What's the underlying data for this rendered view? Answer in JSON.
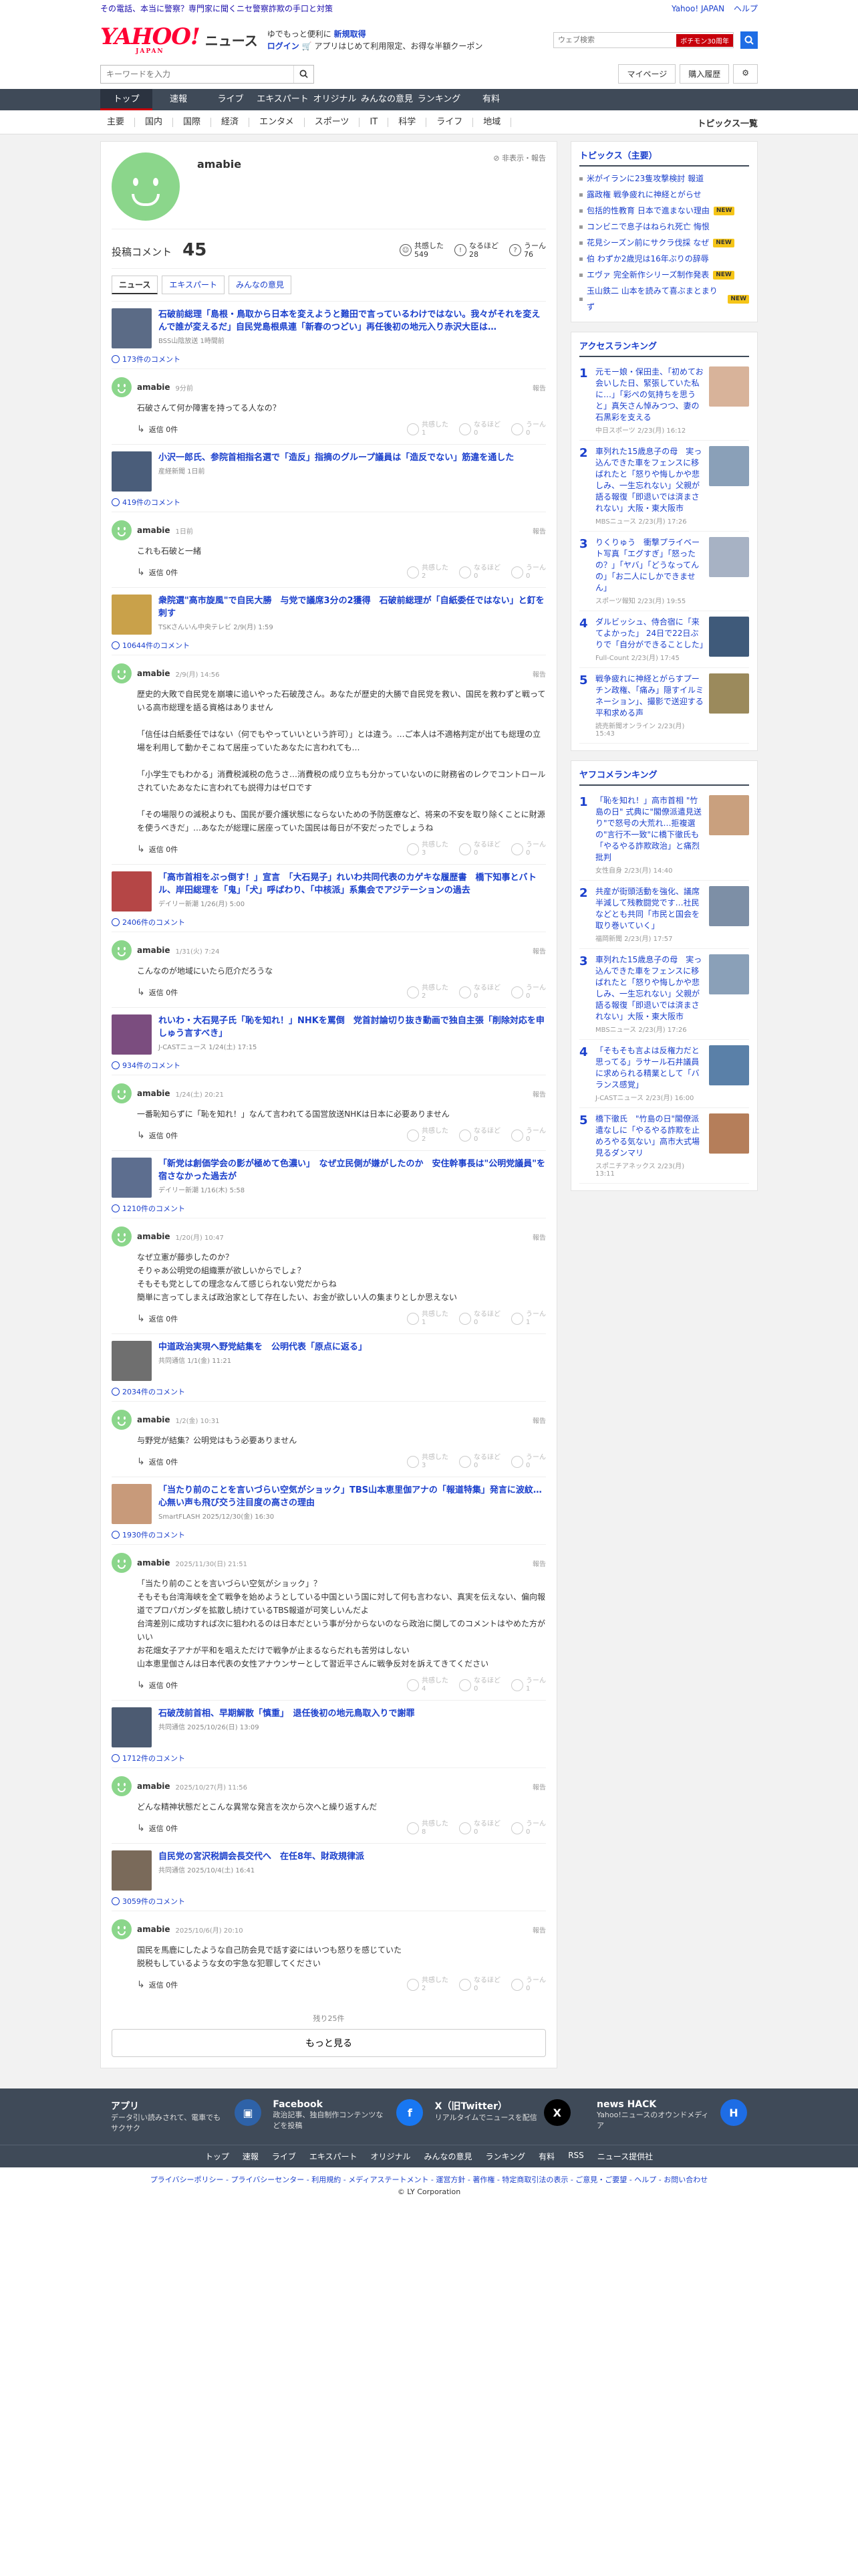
{
  "adbar": {
    "left": "その電話、本当に警察？専門家に聞くニセ警察詐欺の手口と対策",
    "right_links": [
      "Yahoo! JAPAN",
      "ヘルプ"
    ]
  },
  "header": {
    "logo_main": "YAHOO!",
    "logo_sub": "JAPAN",
    "logo_news": "ニュース",
    "promo_line1_a": "ゆでもっと便利に",
    "promo_line1_b": "新規取得",
    "promo_line2_a": "ログイン",
    "promo_line2_b": "アプリはじめて利用限定、お得な半額クーポン",
    "search_placeholder": "ウェブ検索",
    "search_tag": "ボチモン30周年"
  },
  "search_row": {
    "placeholder": "キーワードを入力",
    "mypage": "マイページ",
    "history": "購入履歴"
  },
  "nav": [
    "トップ",
    "速報",
    "ライブ",
    "エキスパート",
    "オリジナル",
    "みんなの意見",
    "ランキング",
    "有料"
  ],
  "subnav": [
    "主要",
    "国内",
    "国際",
    "経済",
    "エンタメ",
    "スポーツ",
    "IT",
    "科学",
    "ライフ",
    "地域"
  ],
  "subnav_all": "トピックス一覧",
  "profile": {
    "name": "amabie",
    "links": "非表示・報告",
    "comments_label": "投稿コメント",
    "comments_count": "45",
    "stats": [
      {
        "label": "共感した",
        "value": "549"
      },
      {
        "label": "なるほど",
        "value": "28"
      },
      {
        "label": "うーん",
        "value": "76"
      }
    ],
    "tabs": [
      "ニュース",
      "エキスパート",
      "みんなの意見"
    ]
  },
  "items": [
    {
      "title": "石破前総理「島根・鳥取から日本を変えようと難田で言っているわけではない。我々がそれを変えんで誰が変えるだ」自民党島根県連「新春のつどい」再任後初の地元入り赤沢大臣は…",
      "meta": "BSS山陰放送 1時間前",
      "thumb": "#5b6b86",
      "comment_count": "173件のコメント",
      "user": "amabie",
      "time": "9分前",
      "body": "石破さんて何か障害を持ってる人なの？",
      "reply": "返信 0件",
      "reacts": [
        "1",
        "0",
        "0"
      ]
    },
    {
      "title": "小沢一郎氏、参院首相指名選で「造反」指摘のグループ議員は「造反でない」筋違を通した",
      "meta": "産経新聞 1日前",
      "thumb": "#4a5d7a",
      "comment_count": "419件のコメント",
      "user": "amabie",
      "time": "1日前",
      "body": "これも石破と一緒",
      "reply": "返信 0件",
      "reacts": [
        "2",
        "0",
        "0"
      ]
    },
    {
      "title": "衆院選\"高市旋風\"で自民大勝　与党で議席3分の2獲得　石破前総理が「自紙委任ではない」と釘を刺す",
      "meta": "TSKさんいん中央テレビ 2/9(月) 1:59",
      "thumb": "#c9a14a",
      "comment_count": "10644件のコメント",
      "user": "amabie",
      "time": "2/9(月) 14:56",
      "body": "歴史的大敗で自民党を崩壊に追いやった石破茂さん。あなたが歴史的大勝で自民党を救い、国民を救わずと戦っている高市総理を語る資格はありません\n\n「信任は白紙委任ではない（何でもやっていいという許可）」とは違う。…ご本人は不適格判定が出ても総理の立場を利用して動かそこねて居座っていたあなたに言われても…\n\n「小学生でもわかる」消費税減税の危うさ…消費税の成り立ちも分かっていないのに財務省のレクでコントロールされていたあなたに言われても説得力はゼロです\n\n「その場限りの減税よりも、国民が要介護状態にならないための予防医療など、将来の不安を取り除くことに財源を使うべきだ」…あなたが総理に居座っていた国民は毎日が不安だったでしょうね",
      "reply": "返信 0件",
      "reacts": [
        "3",
        "0",
        "0"
      ]
    },
    {
      "title": "「高市首相をぶっ倒す！」宣言　「大石晃子」れいわ共同代表のカゲキな履歴書　橋下知事とバトル、岸田総理を「鬼」「犬」呼ばわり、「中核派」系集会でアジテーションの過去",
      "meta": "デイリー新潮 1/26(月) 5:00",
      "thumb": "#b54646",
      "comment_count": "2406件のコメント",
      "user": "amabie",
      "time": "1/31(火) 7:24",
      "body": "こんなのが地域にいたら厄介だろうな",
      "reply": "返信 0件",
      "reacts": [
        "2",
        "0",
        "0"
      ]
    },
    {
      "title": "れいわ・大石晃子氏「恥を知れ！」NHKを罵倒　党首討論切り抜き動画で独自主張「削除対応を申しゅう言すべき」",
      "meta": "J-CASTニュース 1/24(土) 17:15",
      "thumb": "#7b4d7f",
      "comment_count": "934件のコメント",
      "user": "amabie",
      "time": "1/24(土) 20:21",
      "body": "一番恥知らずに「恥を知れ！」なんて言われてる国営放送NHKは日本に必要ありません",
      "reply": "返信 0件",
      "reacts": [
        "2",
        "0",
        "0"
      ]
    },
    {
      "title": "「新党は創価学会の影が極めて色濃い」　なぜ立民側が嫌がしたのか　安住幹事長は\"公明党議員\"を宿さなかった過去が",
      "meta": "デイリー新潮 1/16(木) 5:58",
      "thumb": "#5d6e8f",
      "comment_count": "1210件のコメント",
      "user": "amabie",
      "time": "1/20(月) 10:47",
      "body": "なぜ立憲が藤歩したのか？\nそりゃあ公明党の組織票が欲しいからでしょ？\nそもそも党としての理念なんて感じられない党だからね\n簡単に言ってしまえば政治家として存在したい、お金が欲しい人の集まりとしか思えない",
      "reply": "返信 0件",
      "reacts": [
        "1",
        "0",
        "1"
      ]
    },
    {
      "title": "中道政治実現へ野党結集を　公明代表「原点に返る」",
      "meta": "共同通信 1/1(金) 11:21",
      "thumb": "#6f6f6f",
      "comment_count": "2034件のコメント",
      "user": "amabie",
      "time": "1/2(金) 10:31",
      "body": "与野党が結集？公明党はもう必要ありません",
      "reply": "返信 0件",
      "reacts": [
        "3",
        "0",
        "0"
      ]
    },
    {
      "title": "「当たり前のことを言いづらい空気がショック」TBS山本恵里伽アナの「報道特集」発言に波紋…心無い声も飛び交う注目度の高さの理由",
      "meta": "SmartFLASH 2025/12/30(金) 16:30",
      "thumb": "#c89a7a",
      "comment_count": "1930件のコメント",
      "user": "amabie",
      "time": "2025/11/30(日) 21:51",
      "body": "「当たり前のことを言いづらい空気がショック」？\nそもそも台湾海峡を全て戦争を始めようとしている中国という国に対して何も言わない、真実を伝えない、偏向報道でプロパガンダを拡散し続けているTBS報道が可笑しいんだよ\n台湾差別に成功すれば次に狙われるのは日本だという事が分からないのなら政治に関してのコメントはやめた方がいい\nお花畑女子アナが平和を唱えただけで戦争が止まるならだれも苦労はしない\n山本恵里伽さんは日本代表の女性アナウンサーとして習近平さんに戦争反対を訴えてきてください",
      "reply": "返信 0件",
      "reacts": [
        "4",
        "0",
        "1"
      ]
    },
    {
      "title": "石破茂前首相、早期解散「慎重」　退任後初の地元鳥取入りで謝罪",
      "meta": "共同通信 2025/10/26(日) 13:09",
      "thumb": "#4c5b72",
      "comment_count": "1712件のコメント",
      "user": "amabie",
      "time": "2025/10/27(月) 11:56",
      "body": "どんな精神状態だとこんな異常な発言を次から次へと繰り返すんだ",
      "reply": "返信 0件",
      "reacts": [
        "8",
        "0",
        "0"
      ]
    },
    {
      "title": "自民党の宮沢税調会長交代へ　在任8年、財政規律派",
      "meta": "共同通信 2025/10/4(土) 16:41",
      "thumb": "#7a6a5a",
      "comment_count": "3059件のコメント",
      "user": "amabie",
      "time": "2025/10/6(月) 20:10",
      "body": "国民を馬鹿にしたような自己防会見で話す姿にはいつも怒りを感じていた\n脱税もしているような女の宇急な犯罪してください",
      "reply": "返信 0件",
      "reacts": [
        "2",
        "0",
        "0"
      ]
    }
  ],
  "react_labels": [
    "共感した",
    "なるほど",
    "うーん"
  ],
  "report_label": "報告",
  "more": {
    "remain": "残り25件",
    "button": "もっと見る"
  },
  "sidebar": {
    "topics_title": "トピックス（主要）",
    "topics": [
      {
        "text": "米がイランに23隻攻撃検討 報道",
        "badge": ""
      },
      {
        "text": "露政権 戦争疲れに神経とがらせ",
        "badge": ""
      },
      {
        "text": "包括的性教育 日本で進まない理由",
        "badge": "NEW"
      },
      {
        "text": "コンビニで息子はねられ死亡 悔恨",
        "badge": ""
      },
      {
        "text": "花見シーズン前にサクラ伐採 なぜ",
        "badge": "NEW"
      },
      {
        "text": "伯 わずか2歳児は16年ぶりの辞辱",
        "badge": ""
      },
      {
        "text": "エヴァ 完全新作シリーズ制作発表",
        "badge": "NEW"
      },
      {
        "text": "玉山鉄二 山本を読みて喜ぶまとまりず",
        "badge": "NEW"
      }
    ],
    "access_title": "アクセスランキング",
    "access": [
      {
        "no": "1",
        "title": "元モー娘・保田圭、「初めてお会いした日、緊張していた私に…」「彩ぺの気持ちを思うと」真矢さん悼みつつ、妻の石黒彩を支える",
        "meta": "中日スポーツ 2/23(月) 16:12",
        "img": "#d8b39a"
      },
      {
        "no": "2",
        "title": "車列れた15歳息子の母　実っ込んできた車をフェンスに移ばれたと「怒りや悔しかや悲しみ、一生忘れない」父親が語る報復「即退いでは済まされない」大阪・東大阪市",
        "meta": "MBSニュース 2/23(月) 17:26",
        "img": "#8aa0b8"
      },
      {
        "no": "3",
        "title": "りくりゅう　衝撃プライベート写真「エグすぎ」「怒ったの？」「ヤバ」「どうなってんの」「お二人にしかできません」",
        "meta": "スポーツ報知 2/23(月) 19:55",
        "img": "#a7b2c4"
      },
      {
        "no": "4",
        "title": "ダルビッシュ、侍合宿に「来てよかった」 24日で22日ぶりで「自分ができることした」",
        "meta": "Full-Count 2/23(月) 17:45",
        "img": "#3f5a7a"
      },
      {
        "no": "5",
        "title": "戦争疲れに神経とがらすプーチン政権、「痛み」隠すイルミネーション」、撮影で送迎する平和求める声",
        "meta": "読売新聞オンライン 2/23(月) 15:43",
        "img": "#9b8a5c"
      }
    ],
    "yafoo_title": "ヤフコメランキング",
    "yafoo": [
      {
        "no": "1",
        "title": "「恥を知れ！」高市首相 \"竹島の日\" 式典に\"閣僚派遣見送り\"で怒号の大荒れ…拒複選の\"言行不一致\"に橋下徹氏も「やるやる詐欺政治」と痛烈批判",
        "meta": "女性自身 2/23(月) 14:40",
        "img": "#c9a07e"
      },
      {
        "no": "2",
        "title": "共産が街頭活動を強化、議席半減して残教闘党です…社民などとも共同「市民と国会を取り巻いていく」",
        "meta": "福岡新聞 2/23(月) 17:57",
        "img": "#7d8fa6"
      },
      {
        "no": "3",
        "title": "車列れた15歳息子の母　実っ込んできた車をフェンスに移ばれたと「怒りや悔しかや悲しみ、一生忘れない」父親が語る報復「即退いでは済まされない」大阪・東大阪市",
        "meta": "MBSニュース 2/23(月) 17:26",
        "img": "#8aa0b8"
      },
      {
        "no": "4",
        "title": "「そもそも言よは反権力だと思ってる」ラサール石井議員に求められる精業として「バランス感覚」",
        "meta": "J-CASTニュース 2/23(月) 16:00",
        "img": "#5a80a8"
      },
      {
        "no": "5",
        "title": "橋下徹氏　\"竹島の日\"閣僚派遣なしに「やるやる詐欺を止めろやる気ない」高市大式場見るダンマリ",
        "meta": "スポニチアネックス 2/23(月) 13:11",
        "img": "#b57e5a"
      }
    ]
  },
  "footer": {
    "apps": [
      {
        "name": "アプリ",
        "desc": "データ引い読みされて、電車でもサクサク",
        "icon": "#2e62a8",
        "glyph": "▣"
      },
      {
        "name": "Facebook",
        "desc": "政治記事、独自制作コンテンツなどを投稿",
        "icon": "#1877f2",
        "glyph": "f"
      },
      {
        "name": "X（旧Twitter）",
        "desc": "リアルタイムでニュースを配信",
        "icon": "#000000",
        "glyph": "X"
      },
      {
        "name": "news HACK",
        "desc": "Yahoo!ニュースのオウンドメディア",
        "icon": "#1e6de5",
        "glyph": "H"
      }
    ],
    "nav": [
      "トップ",
      "速報",
      "ライブ",
      "エキスパート",
      "オリジナル",
      "みんなの意見",
      "ランキング",
      "有料",
      "RSS",
      "ニュース提供社"
    ],
    "links": "プライバシーポリシー - プライバシーセンター - 利用規約 - メディアステートメント - 運営方針 - 著作権 - 特定商取引法の表示 - ご意見・ご要望 - ヘルプ - お問い合わせ",
    "copyright": "© LY Corporation"
  },
  "colors": {
    "accent": "#1a3fcc",
    "nav": "#3f4a58",
    "brand": "#ff0033"
  }
}
